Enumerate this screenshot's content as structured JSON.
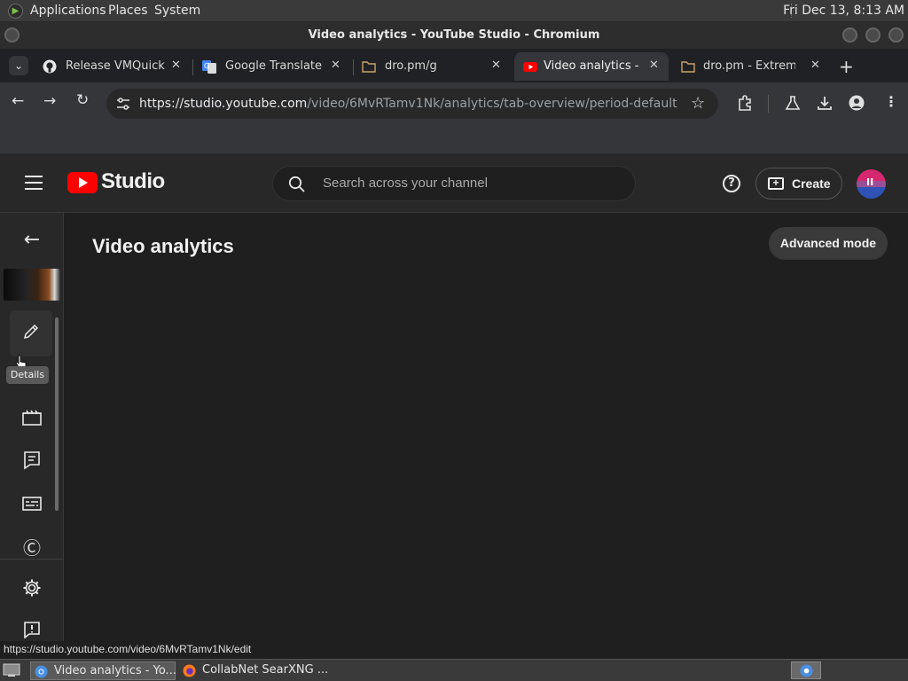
{
  "os_panel": {
    "menus": [
      "Applications",
      "Places",
      "System"
    ],
    "clock": "Fri Dec 13,  8:13 AM"
  },
  "window": {
    "title": "Video analytics - YouTube Studio - Chromium"
  },
  "tabs": [
    {
      "label": "Release VMQuickC",
      "icon": "github-icon"
    },
    {
      "label": "Google Translate",
      "icon": "google-translate-icon"
    },
    {
      "label": "dro.pm/g",
      "icon": "folder-icon"
    },
    {
      "label": "Video analytics - Yo",
      "icon": "youtube-icon",
      "active": true
    },
    {
      "label": "dro.pm - Extremel",
      "icon": "folder-icon"
    }
  ],
  "toolbar": {
    "url_host": "https://studio.youtube.com",
    "url_path": "/video/6MvRTamv1Nk/analytics/tab-overview/period-default"
  },
  "studio": {
    "brand": "Studio",
    "search_placeholder": "Search across your channel",
    "create_label": "Create",
    "page_title": "Video analytics",
    "advanced_mode_label": "Advanced mode",
    "details_tooltip": "Details"
  },
  "status_url": "https://studio.youtube.com/video/6MvRTamv1Nk/edit",
  "taskbar": {
    "tasks": [
      {
        "label": "Video analytics - Yo...",
        "icon": "chromium-icon"
      },
      {
        "label": "CollabNet SearXNG ...",
        "icon": "firefox-icon"
      }
    ]
  },
  "colors": {
    "youtube_red": "#ff0000",
    "background": "#1f1f1f",
    "header": "#282828"
  }
}
